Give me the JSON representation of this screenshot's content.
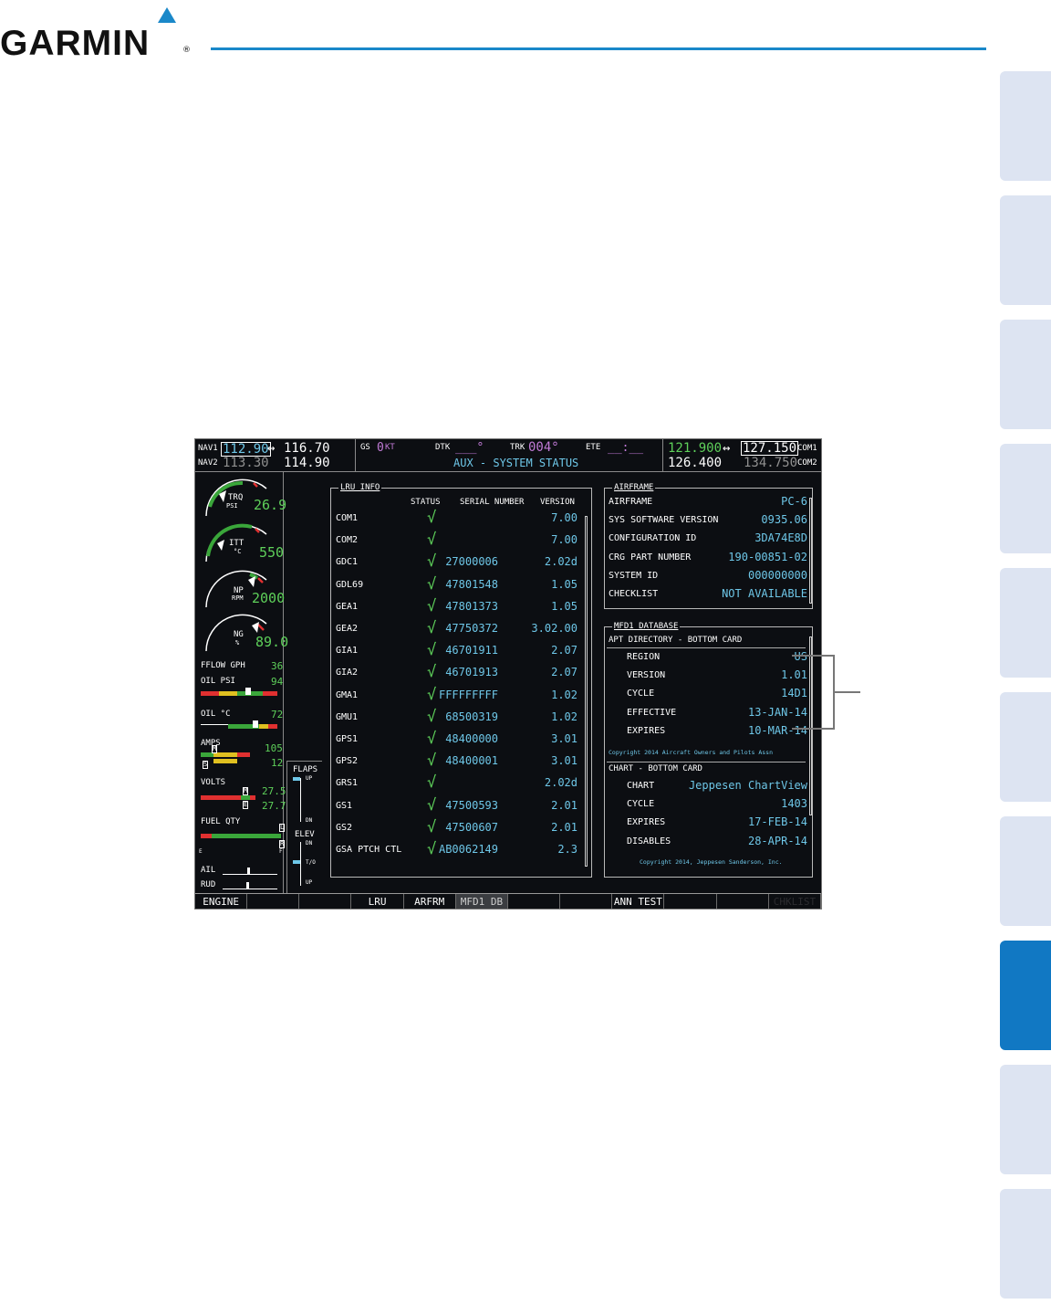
{
  "brand": {
    "name": "GARMIN",
    "reg": "®"
  },
  "tabs": [
    {
      "active": false
    },
    {
      "active": false
    },
    {
      "active": false
    },
    {
      "active": false
    },
    {
      "active": false
    },
    {
      "active": false
    },
    {
      "active": false
    },
    {
      "active": true
    },
    {
      "active": false
    },
    {
      "active": false
    }
  ],
  "topbar": {
    "nav1_label": "NAV1",
    "nav1_active": "112.90",
    "nav1_standby": "116.70",
    "nav2_label": "NAV2",
    "nav2_active": "113.30",
    "nav2_standby": "114.90",
    "swap_glyph": "↔",
    "gs_label": "GS",
    "gs_value": "0",
    "gs_unit": "KT",
    "dtk_label": "DTK",
    "dtk_value": "___°",
    "trk_label": "TRK",
    "trk_value": "004°",
    "ete_label": "ETE",
    "ete_value": "__:__",
    "page_title": "AUX - SYSTEM STATUS",
    "com1_active": "121.900",
    "com1_standby": "127.150",
    "com1_label": "COM1",
    "com2_active": "126.400",
    "com2_standby": "134.750",
    "com2_label": "COM2"
  },
  "eis": {
    "trq": {
      "label": "TRQ",
      "unit": "PSI",
      "value": "26.9"
    },
    "itt": {
      "label": "ITT",
      "unit": "°C",
      "value": "550"
    },
    "np": {
      "label": "NP",
      "unit": "RPM",
      "value": "2000"
    },
    "ng": {
      "label": "NG",
      "unit": "%",
      "value": "89.0"
    },
    "fflow": {
      "label": "FFLOW GPH",
      "value": "36"
    },
    "oil_psi": {
      "label": "OIL PSI",
      "value": "94",
      "level": 0.62
    },
    "oil_c": {
      "label": "OIL °C",
      "value": "72",
      "level": 0.72
    },
    "amps": {
      "label": "AMPS",
      "value1": "105",
      "value2": "12",
      "mark1": "M",
      "mark2": "S"
    },
    "volts": {
      "label": "VOLTS",
      "value1": "27.5",
      "value2": "27.7",
      "mark1": "M",
      "mark2": "E"
    },
    "fuel_qty": {
      "label": "FUEL QTY",
      "e_label": "E",
      "f_label": "F",
      "mark": "L",
      "mark2": "R"
    },
    "flaps": {
      "label": "FLAPS",
      "up": "UP",
      "dn": "DN"
    },
    "elev": {
      "label": "ELEV",
      "dn": "DN",
      "to": "T/O",
      "up": "UP"
    },
    "ail_label": "AIL",
    "rud_label": "RUD"
  },
  "lru": {
    "title": "LRU INFO",
    "col_status": "STATUS",
    "col_serial": "SERIAL NUMBER",
    "col_version": "VERSION",
    "check_glyph": "√",
    "rows": [
      {
        "name": "COM1",
        "ok": true,
        "serial": "",
        "version": "7.00"
      },
      {
        "name": "COM2",
        "ok": true,
        "serial": "",
        "version": "7.00"
      },
      {
        "name": "GDC1",
        "ok": true,
        "serial": "27000006",
        "version": "2.02d"
      },
      {
        "name": "GDL69",
        "ok": true,
        "serial": "47801548",
        "version": "1.05"
      },
      {
        "name": "GEA1",
        "ok": true,
        "serial": "47801373",
        "version": "1.05"
      },
      {
        "name": "GEA2",
        "ok": true,
        "serial": "47750372",
        "version": "3.02.00"
      },
      {
        "name": "GIA1",
        "ok": true,
        "serial": "46701911",
        "version": "2.07"
      },
      {
        "name": "GIA2",
        "ok": true,
        "serial": "46701913",
        "version": "2.07"
      },
      {
        "name": "GMA1",
        "ok": true,
        "serial": "FFFFFFFFF",
        "version": "1.02"
      },
      {
        "name": "GMU1",
        "ok": true,
        "serial": "68500319",
        "version": "1.02"
      },
      {
        "name": "GPS1",
        "ok": true,
        "serial": "48400000",
        "version": "3.01"
      },
      {
        "name": "GPS2",
        "ok": true,
        "serial": "48400001",
        "version": "3.01"
      },
      {
        "name": "GRS1",
        "ok": true,
        "serial": "",
        "version": "2.02d"
      },
      {
        "name": "GS1",
        "ok": true,
        "serial": "47500593",
        "version": "2.01"
      },
      {
        "name": "GS2",
        "ok": true,
        "serial": "47500607",
        "version": "2.01"
      },
      {
        "name": "GSA PTCH CTL",
        "ok": true,
        "serial": "AB0062149",
        "version": "2.3"
      }
    ]
  },
  "airframe": {
    "title": "AIRFRAME",
    "rows": [
      {
        "label": "AIRFRAME",
        "value": "PC-6"
      },
      {
        "label": "SYS SOFTWARE VERSION",
        "value": "0935.06"
      },
      {
        "label": "CONFIGURATION ID",
        "value": "3DA74E8D"
      },
      {
        "label": "CRG PART NUMBER",
        "value": "190-00851-02"
      },
      {
        "label": "SYSTEM ID",
        "value": "000000000"
      },
      {
        "label": "CHECKLIST",
        "value": "NOT AVAILABLE"
      }
    ]
  },
  "mfd_db": {
    "title": "MFD1 DATABASE",
    "apt_header": "APT DIRECTORY - BOTTOM CARD",
    "apt_rows": [
      {
        "label": "REGION",
        "value": "US"
      },
      {
        "label": "VERSION",
        "value": "1.01"
      },
      {
        "label": "CYCLE",
        "value": "14D1"
      },
      {
        "label": "EFFECTIVE",
        "value": "13-JAN-14"
      },
      {
        "label": "EXPIRES",
        "value": "10-MAR-14"
      }
    ],
    "apt_copyright": "Copyright 2014 Aircraft Owners and Pilots Assn",
    "chart_header": "CHART - BOTTOM CARD",
    "chart_rows": [
      {
        "label": "CHART",
        "value": "Jeppesen ChartView"
      },
      {
        "label": "CYCLE",
        "value": "1403"
      },
      {
        "label": "EXPIRES",
        "value": "17-FEB-14"
      },
      {
        "label": "DISABLES",
        "value": "28-APR-14"
      }
    ],
    "chart_copyright": "Copyright 2014, Jeppesen Sanderson, Inc."
  },
  "softkeys": [
    {
      "label": "ENGINE",
      "state": "normal"
    },
    {
      "label": "",
      "state": "normal"
    },
    {
      "label": "",
      "state": "normal"
    },
    {
      "label": "LRU",
      "state": "normal"
    },
    {
      "label": "ARFRM",
      "state": "normal"
    },
    {
      "label": "MFD1 DB",
      "state": "selected"
    },
    {
      "label": "",
      "state": "normal"
    },
    {
      "label": "",
      "state": "normal"
    },
    {
      "label": "ANN TEST",
      "state": "normal"
    },
    {
      "label": "",
      "state": "normal"
    },
    {
      "label": "",
      "state": "normal"
    },
    {
      "label": "CHKLIST",
      "state": "disabled"
    }
  ],
  "colors": {
    "cyan": "#6ec7e8",
    "green": "#5ed05a",
    "magenta": "#c27bd8",
    "tab_active": "#1178c3",
    "tab_inactive": "#dde4f2"
  }
}
